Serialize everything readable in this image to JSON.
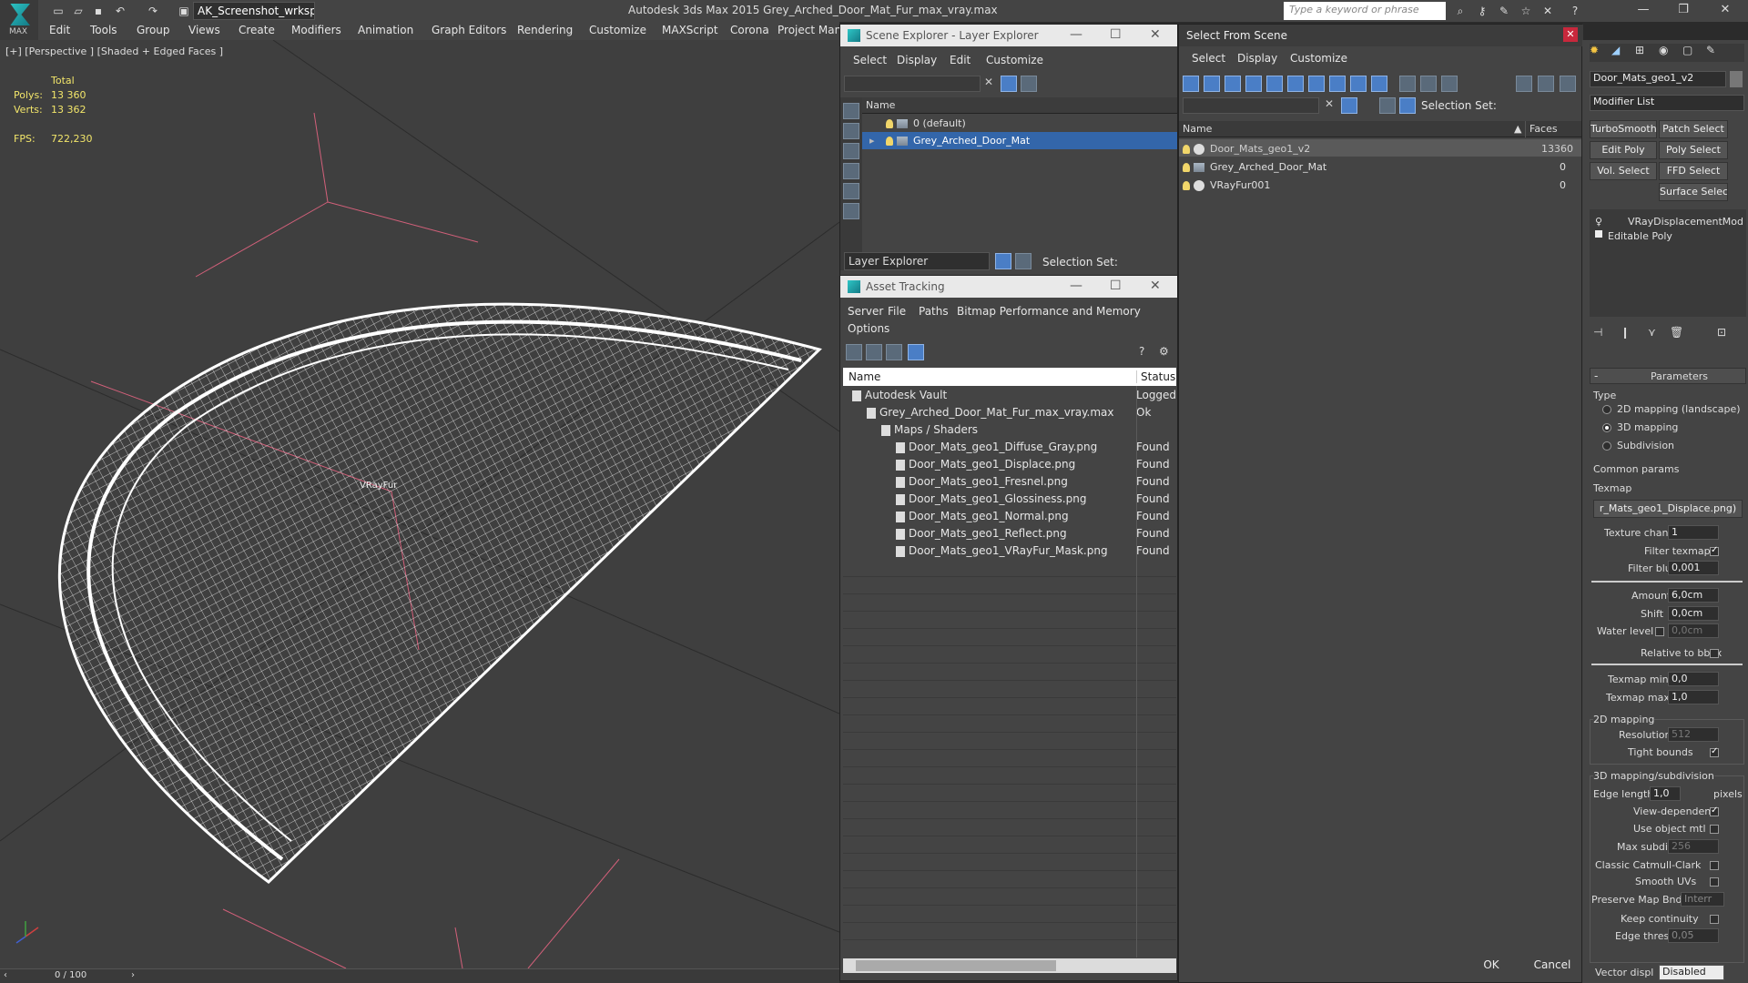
{
  "title_bar": {
    "logo_text": "MAX",
    "workspace": "AK_Screenshot_wrksp",
    "app_title": "Autodesk 3ds Max  2015     Grey_Arched_Door_Mat_Fur_max_vray.max",
    "search_placeholder": "Type a keyword or phrase"
  },
  "menubar": {
    "items": [
      "Edit",
      "Tools",
      "Group",
      "Views",
      "Create",
      "Modifiers",
      "Animation",
      "Graph Editors",
      "Rendering",
      "Customize",
      "MAXScript",
      "Corona",
      "Project Man"
    ]
  },
  "viewport": {
    "label": "[+] [Perspective ] [Shaded + Edged Faces ]",
    "stats": {
      "total_label": "Total",
      "polys_label": "Polys:",
      "polys_value": "13 360",
      "verts_label": "Verts:",
      "verts_value": "13 362",
      "fps_label": "FPS:",
      "fps_value": "722,230"
    },
    "object_label": "VRayFur",
    "timeline": "0 / 100"
  },
  "scene_explorer": {
    "title": "Scene Explorer - Layer Explorer",
    "menu": [
      "Select",
      "Display",
      "Edit",
      "Customize"
    ],
    "column": "Name",
    "rows": [
      {
        "name": "0 (default)",
        "selected": false
      },
      {
        "name": "Grey_Arched_Door_Mat",
        "selected": true
      }
    ],
    "footer_dropdown": "Layer Explorer",
    "selection_set_label": "Selection Set:"
  },
  "asset_tracking": {
    "title": "Asset Tracking",
    "menu": [
      "Server",
      "File",
      "Paths",
      "Bitmap Performance and Memory"
    ],
    "menu2": [
      "Options"
    ],
    "col_name": "Name",
    "col_status": "Status",
    "rows": [
      {
        "name": "Autodesk Vault",
        "status": "Logged",
        "indent": 1
      },
      {
        "name": "Grey_Arched_Door_Mat_Fur_max_vray.max",
        "status": "Ok",
        "indent": 2
      },
      {
        "name": "Maps / Shaders",
        "status": "",
        "indent": 3
      },
      {
        "name": "Door_Mats_geo1_Diffuse_Gray.png",
        "status": "Found",
        "indent": 4
      },
      {
        "name": "Door_Mats_geo1_Displace.png",
        "status": "Found",
        "indent": 4
      },
      {
        "name": "Door_Mats_geo1_Fresnel.png",
        "status": "Found",
        "indent": 4
      },
      {
        "name": "Door_Mats_geo1_Glossiness.png",
        "status": "Found",
        "indent": 4
      },
      {
        "name": "Door_Mats_geo1_Normal.png",
        "status": "Found",
        "indent": 4
      },
      {
        "name": "Door_Mats_geo1_Reflect.png",
        "status": "Found",
        "indent": 4
      },
      {
        "name": "Door_Mats_geo1_VRayFur_Mask.png",
        "status": "Found",
        "indent": 4
      }
    ]
  },
  "select_from_scene": {
    "title": "Select From Scene",
    "menu": [
      "Select",
      "Display",
      "Customize"
    ],
    "selection_set_label": "Selection Set:",
    "col_name": "Name",
    "col_faces": "Faces",
    "rows": [
      {
        "name": "Door_Mats_geo1_v2",
        "faces": "13360",
        "selected": true
      },
      {
        "name": "Grey_Arched_Door_Mat",
        "faces": "0",
        "selected": false
      },
      {
        "name": "VRayFur001",
        "faces": "0",
        "selected": false
      }
    ],
    "ok": "OK",
    "cancel": "Cancel"
  },
  "command_panel": {
    "object_name": "Door_Mats_geo1_v2",
    "modifier_list": "Modifier List",
    "buttons": [
      "TurboSmooth",
      "Patch Select",
      "Edit Poly",
      "Poly Select",
      "Vol. Select",
      "FFD Select",
      "Surface Select"
    ],
    "stack": [
      "VRayDisplacementMod",
      "Editable Poly"
    ],
    "rollout_title": "Parameters",
    "type_label": "Type",
    "type_options": [
      "2D mapping (landscape)",
      "3D mapping",
      "Subdivision"
    ],
    "type_selected": 1,
    "common_params": "Common params",
    "texmap_label": "Texmap",
    "texmap_value": "r_Mats_geo1_Displace.png)",
    "texture_chan_label": "Texture chan",
    "texture_chan_value": "1",
    "filter_texmap_label": "Filter texmap",
    "filter_blur_label": "Filter blur",
    "filter_blur_value": "0,001",
    "amount_label": "Amount",
    "amount_value": "6,0cm",
    "shift_label": "Shift",
    "shift_value": "0,0cm",
    "water_level_label": "Water level",
    "water_level_value": "0,0cm",
    "relative_bbox_label": "Relative to bbox",
    "texmap_min_label": "Texmap min",
    "texmap_min_value": "0,0",
    "texmap_max_label": "Texmap max",
    "texmap_max_value": "1,0",
    "mapping_2d": "2D mapping",
    "resolution_label": "Resolution",
    "resolution_value": "512",
    "tight_bounds_label": "Tight bounds",
    "mapping_3d": "3D mapping/subdivision",
    "edge_length_label": "Edge length",
    "edge_length_value": "1,0",
    "pixels_label": "pixels",
    "view_dependent_label": "View-dependent",
    "use_object_mtl_label": "Use object mtl",
    "max_subdivs_label": "Max subdivs",
    "max_subdivs_value": "256",
    "classic_catmull_label": "Classic Catmull-Clark",
    "smooth_uvs_label": "Smooth UVs",
    "preserve_map_label": "Preserve Map Bnd",
    "preserve_map_value": "Interr",
    "keep_continuity_label": "Keep continuity",
    "edge_thresh_label": "Edge thresh",
    "edge_thresh_value": "0,05",
    "vector_displ_label": "Vector displ",
    "vector_displ_value": "Disabled"
  }
}
